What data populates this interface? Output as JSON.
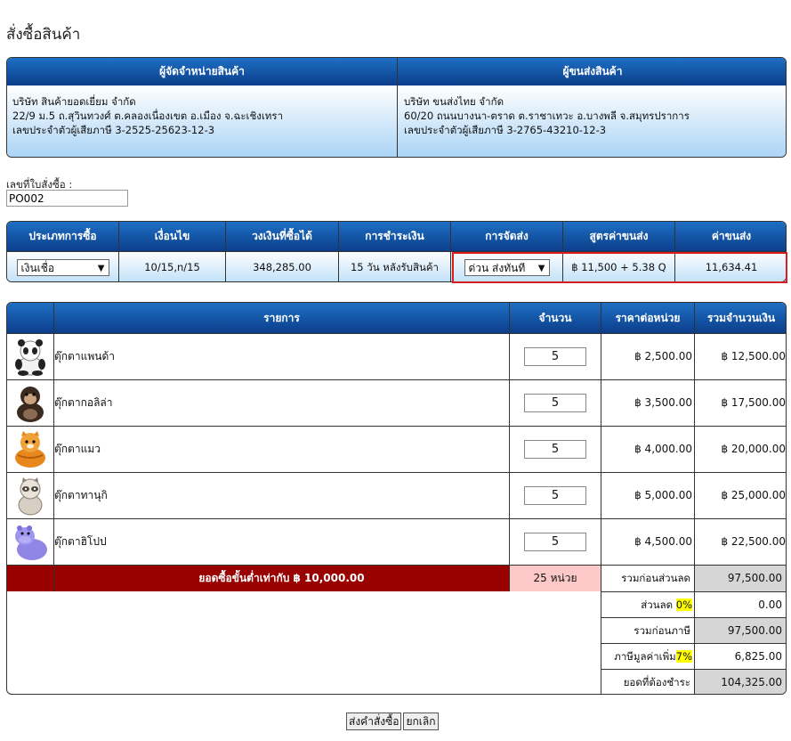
{
  "page": {
    "title": "สั่งซื้อสินค้า"
  },
  "vendor": {
    "header": "ผู้จัดจำหน่ายสินค้า",
    "lines": [
      "บริษัท สินค้ายอดเยี่ยม จำกัด",
      "22/9 ม.5 ถ.สุวินทวงศ์ ต.คลองเนื่องเขต อ.เมือง จ.ฉะเชิงเทรา",
      "เลขประจำตัวผู้เสียภาษี 3-2525-25623-12-3"
    ]
  },
  "shipper": {
    "header": "ผู้ขนส่งสินค้า",
    "lines": [
      "บริษัท ขนส่งไทย จำกัด",
      "60/20 ถนนบางนา-ตราด ต.ราชาเทวะ อ.บางพลี จ.สมุทรปราการ",
      "เลขประจำตัวผู้เสียภาษี 3-2765-43210-12-3"
    ]
  },
  "po": {
    "label": "เลขที่ใบสั่งซื้อ :",
    "value": "PO002"
  },
  "terms": {
    "headers": [
      "ประเภทการซื้อ",
      "เงื่อนไข",
      "วงเงินที่ซื้อได้",
      "การชำระเงิน",
      "การจัดส่ง",
      "สูตรค่าขนส่ง",
      "ค่าขนส่ง"
    ],
    "purchase_type": "เงินเชื่อ",
    "condition": "10/15,n/15",
    "credit_limit": "348,285.00",
    "payment": "15 วัน หลังรับสินค้า",
    "delivery": "ด่วน ส่งทันที",
    "shipping_formula": "฿ 11,500 + 5.38 Q",
    "shipping_cost": "11,634.41",
    "highlight_color": "#d81e1e"
  },
  "items": {
    "headers": [
      "รายการ",
      "จำนวน",
      "ราคาต่อหน่วย",
      "รวมจำนวนเงิน"
    ],
    "rows": [
      {
        "icon": "panda-doll-icon",
        "name": "ตุ๊กตาแพนด้า",
        "qty": "5",
        "price": "฿ 2,500.00",
        "total": "฿ 12,500.00"
      },
      {
        "icon": "gorilla-doll-icon",
        "name": "ตุ๊กตากอลิล่า",
        "qty": "5",
        "price": "฿ 3,500.00",
        "total": "฿ 17,500.00"
      },
      {
        "icon": "cat-doll-icon",
        "name": "ตุ๊กตาแมว",
        "qty": "5",
        "price": "฿ 4,000.00",
        "total": "฿ 20,000.00"
      },
      {
        "icon": "raccoon-doll-icon",
        "name": "ตุ๊กตาทานุกิ",
        "qty": "5",
        "price": "฿ 5,000.00",
        "total": "฿ 25,000.00"
      },
      {
        "icon": "hippo-doll-icon",
        "name": "ตุ๊กตาฮิโปป",
        "qty": "5",
        "price": "฿ 4,500.00",
        "total": "฿ 22,500.00"
      }
    ],
    "minimum_text": "ยอดซื้อขั้นต่ำเท่ากับ ฿ 10,000.00",
    "total_units": "25  หน่วย"
  },
  "summary": {
    "subtotal_label": "รวมก่อนส่วนลด",
    "subtotal": "97,500.00",
    "discount_label": "ส่วนลด",
    "discount_pct": "0%",
    "discount": "0.00",
    "pretax_label": "รวมก่อนภาษี",
    "pretax": "97,500.00",
    "vat_label": "ภาษีมูลค่าเพิ่ม",
    "vat_pct": "7%",
    "vat": "6,825.00",
    "grand_label": "ยอดที่ต้องชำระ",
    "grand": "104,325.00"
  },
  "buttons": {
    "submit": "ส่งคำสั่งซื้อ",
    "cancel": "ยกเลิก"
  },
  "colors": {
    "header_blue": "#0b3e8a",
    "min_bar": "#990000",
    "units_bg": "#fcc8c8"
  }
}
